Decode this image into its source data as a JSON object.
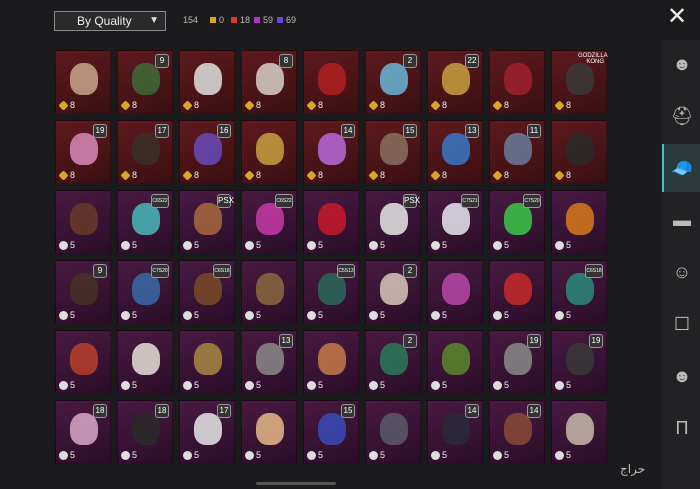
{
  "filter": {
    "label": "By Quality",
    "chevron": "chevron-down-icon"
  },
  "summary": {
    "total": "154",
    "counts": [
      {
        "value": "0",
        "color": "#d9a527"
      },
      {
        "value": "18",
        "color": "#d83838"
      },
      {
        "value": "59",
        "color": "#b531c4"
      },
      {
        "value": "69",
        "color": "#6a43d8"
      }
    ]
  },
  "close_icon": "close-icon",
  "tabs": [
    {
      "name": "head-tab",
      "icon": "head-icon",
      "active": false
    },
    {
      "name": "helmet-tab",
      "icon": "helmet-icon",
      "active": false
    },
    {
      "name": "hat-tab",
      "icon": "cap-icon",
      "active": true
    },
    {
      "name": "glasses-tab",
      "icon": "glasses-icon",
      "active": false
    },
    {
      "name": "face-tab",
      "icon": "face-icon",
      "active": false
    },
    {
      "name": "top-tab",
      "icon": "jacket-icon",
      "active": false
    },
    {
      "name": "mask-tab",
      "icon": "mask-icon",
      "active": false
    },
    {
      "name": "pants-tab",
      "icon": "pants-icon",
      "active": false
    }
  ],
  "items": [
    {
      "q": "red",
      "qty": "8",
      "badge": "",
      "c": "#c8a68a"
    },
    {
      "q": "red",
      "qty": "8",
      "badge": "9",
      "c": "#3f6a3a"
    },
    {
      "q": "red",
      "qty": "8",
      "badge": "",
      "c": "#e0e0e0"
    },
    {
      "q": "red",
      "qty": "8",
      "badge": "8",
      "c": "#d8d0c8"
    },
    {
      "q": "red",
      "qty": "8",
      "badge": "",
      "c": "#b32020"
    },
    {
      "q": "red",
      "qty": "8",
      "badge": "2",
      "c": "#6ab6d8"
    },
    {
      "q": "red",
      "qty": "8",
      "badge": "22",
      "c": "#c8a040"
    },
    {
      "q": "red",
      "qty": "8",
      "badge": "",
      "c": "#a02030"
    },
    {
      "q": "red",
      "qty": "8",
      "badge": "",
      "c": "#3a3a3a",
      "label": "GODZILLA KONG"
    },
    {
      "q": "red",
      "qty": "8",
      "badge": "19",
      "c": "#d88ab8"
    },
    {
      "q": "red",
      "qty": "8",
      "badge": "17",
      "c": "#3a3028"
    },
    {
      "q": "red",
      "qty": "8",
      "badge": "16",
      "c": "#6a4ab8"
    },
    {
      "q": "red",
      "qty": "8",
      "badge": "",
      "c": "#c8a040"
    },
    {
      "q": "red",
      "qty": "8",
      "badge": "14",
      "c": "#b868d8"
    },
    {
      "q": "red",
      "qty": "8",
      "badge": "15",
      "c": "#8a7060"
    },
    {
      "q": "red",
      "qty": "8",
      "badge": "13",
      "c": "#3a78c8"
    },
    {
      "q": "red",
      "qty": "8",
      "badge": "11",
      "c": "#6a7a9a"
    },
    {
      "q": "red",
      "qty": "8",
      "badge": "",
      "c": "#2a2a2a"
    },
    {
      "q": "purple",
      "qty": "5",
      "badge": "",
      "c": "#6a3a2a"
    },
    {
      "q": "purple",
      "qty": "5",
      "badge": "C6S22",
      "c": "#48b8b8"
    },
    {
      "q": "purple",
      "qty": "5",
      "badge": "PSX",
      "c": "#a86a40"
    },
    {
      "q": "purple",
      "qty": "5",
      "badge": "C6S22",
      "c": "#c83aa8"
    },
    {
      "q": "purple",
      "qty": "5",
      "badge": "",
      "c": "#c81a2a"
    },
    {
      "q": "purple",
      "qty": "5",
      "badge": "PSX",
      "c": "#e8e8e8"
    },
    {
      "q": "purple",
      "qty": "5",
      "badge": "C7S21",
      "c": "#e8e8f0"
    },
    {
      "q": "purple",
      "qty": "5",
      "badge": "C7S20",
      "c": "#3ac84a"
    },
    {
      "q": "purple",
      "qty": "5",
      "badge": "",
      "c": "#d87a1a"
    },
    {
      "q": "purple",
      "qty": "5",
      "badge": "9",
      "c": "#4a3028"
    },
    {
      "q": "purple",
      "qty": "5",
      "badge": "C7S20",
      "c": "#3a6aa8"
    },
    {
      "q": "purple",
      "qty": "5",
      "badge": "C6S18",
      "c": "#7a4a28"
    },
    {
      "q": "purple",
      "qty": "5",
      "badge": "",
      "c": "#8a6a40"
    },
    {
      "q": "purple",
      "qty": "5",
      "badge": "C5S13",
      "c": "#2a6a5a"
    },
    {
      "q": "purple",
      "qty": "5",
      "badge": "2",
      "c": "#d8c8b8"
    },
    {
      "q": "purple",
      "qty": "5",
      "badge": "",
      "c": "#b848a8"
    },
    {
      "q": "purple",
      "qty": "5",
      "badge": "",
      "c": "#c82a2a"
    },
    {
      "q": "purple",
      "qty": "5",
      "badge": "C6S18",
      "c": "#2a8a7a"
    },
    {
      "q": "purple",
      "qty": "5",
      "badge": "",
      "c": "#b8402a"
    },
    {
      "q": "purple",
      "qty": "5",
      "badge": "",
      "c": "#e8e0d8"
    },
    {
      "q": "purple",
      "qty": "5",
      "badge": "",
      "c": "#a88a40"
    },
    {
      "q": "purple",
      "qty": "5",
      "badge": "13",
      "c": "#8a8a8a"
    },
    {
      "q": "purple",
      "qty": "5",
      "badge": "",
      "c": "#c87a4a"
    },
    {
      "q": "purple",
      "qty": "5",
      "badge": "2",
      "c": "#2a7a5a"
    },
    {
      "q": "purple",
      "qty": "5",
      "badge": "",
      "c": "#5a8a2a"
    },
    {
      "q": "purple",
      "qty": "5",
      "badge": "19",
      "c": "#8a8a8a"
    },
    {
      "q": "purple",
      "qty": "5",
      "badge": "19",
      "c": "#3a3a3a"
    },
    {
      "q": "purple",
      "qty": "5",
      "badge": "18",
      "c": "#d8a8c8"
    },
    {
      "q": "purple",
      "qty": "5",
      "badge": "18",
      "c": "#2a2a2a"
    },
    {
      "q": "purple",
      "qty": "5",
      "badge": "17",
      "c": "#e8e8e8"
    },
    {
      "q": "purple",
      "qty": "5",
      "badge": "",
      "c": "#e8b888"
    },
    {
      "q": "purple",
      "qty": "5",
      "badge": "15",
      "c": "#3a4ab8"
    },
    {
      "q": "purple",
      "qty": "5",
      "badge": "",
      "c": "#5a5a6a"
    },
    {
      "q": "purple",
      "qty": "5",
      "badge": "14",
      "c": "#2a2a3a"
    },
    {
      "q": "purple",
      "qty": "5",
      "badge": "14",
      "c": "#8a4a3a"
    },
    {
      "q": "purple",
      "qty": "5",
      "badge": "",
      "c": "#c8b8a8"
    }
  ],
  "watermark": "حراج"
}
